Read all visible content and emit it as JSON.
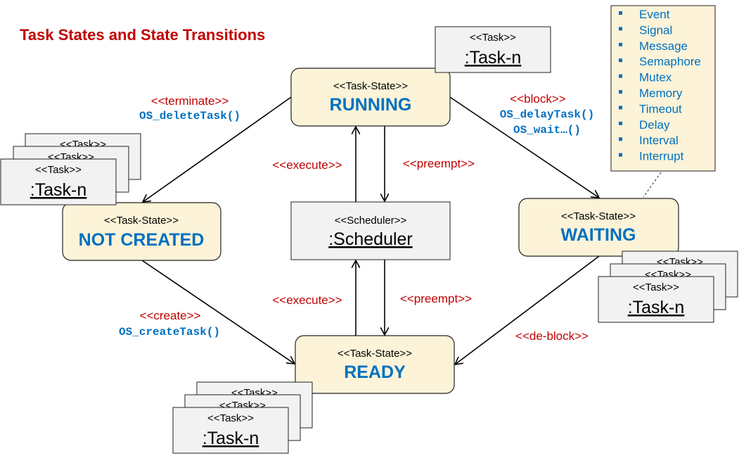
{
  "title": "Task States and State Transitions",
  "colors": {
    "label_red": "#c00000",
    "accent_blue": "#0070c0",
    "state_fill": "#fcf3d8",
    "object_fill": "#f2f2f2"
  },
  "states": {
    "running": {
      "stereotype": "<<Task-State>>",
      "name": "RUNNING"
    },
    "not_created": {
      "stereotype": "<<Task-State>>",
      "name": "NOT CREATED"
    },
    "waiting": {
      "stereotype": "<<Task-State>>",
      "name": "WAITING"
    },
    "ready": {
      "stereotype": "<<Task-State>>",
      "name": "READY"
    }
  },
  "scheduler": {
    "stereotype": "<<Scheduler>>",
    "name": ":Scheduler"
  },
  "task": {
    "stereotype": "<<Task>>",
    "name": ":Task-n"
  },
  "transitions": {
    "terminate": {
      "label": "<<terminate>>",
      "call": "OS_deleteTask()"
    },
    "block": {
      "label": "<<block>>",
      "calls": [
        "OS_delayTask()",
        "OS_wait…()"
      ]
    },
    "execute_top": {
      "label": "<<execute>>"
    },
    "preempt_top": {
      "label": "<<preempt>>"
    },
    "execute_bottom": {
      "label": "<<execute>>"
    },
    "preempt_bottom": {
      "label": "<<preempt>>"
    },
    "create": {
      "label": "<<create>>",
      "call": "OS_createTask()"
    },
    "deblock": {
      "label": "<<de-block>>"
    }
  },
  "wait_events": [
    "Event",
    "Signal",
    "Message",
    "Semaphore",
    "Mutex",
    "Memory",
    "Timeout",
    "Delay",
    "Interval",
    "Interrupt"
  ]
}
